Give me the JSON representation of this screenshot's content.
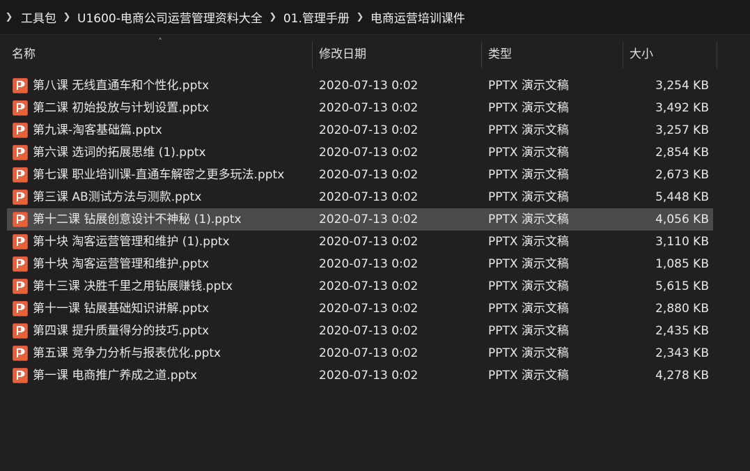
{
  "breadcrumb": {
    "items": [
      "工具包",
      "U1600-电商公司运营管理资料大全",
      "01.管理手册",
      "电商运营培训课件"
    ]
  },
  "columns": {
    "name": "名称",
    "date": "修改日期",
    "type": "类型",
    "size": "大小"
  },
  "icons": {
    "separator": "chevron-right-icon",
    "file": "pptx-file-icon",
    "sort": "sort-ascending-icon"
  },
  "colors": {
    "pptx_icon": "#e8613c",
    "selection": "#4a4a4a"
  },
  "files": [
    {
      "name": "第八课 无线直通车和个性化.pptx",
      "date": "2020-07-13 0:02",
      "type": "PPTX 演示文稿",
      "size": "3,254 KB"
    },
    {
      "name": "第二课 初始投放与计划设置.pptx",
      "date": "2020-07-13 0:02",
      "type": "PPTX 演示文稿",
      "size": "3,492 KB"
    },
    {
      "name": "第九课-淘客基础篇.pptx",
      "date": "2020-07-13 0:02",
      "type": "PPTX 演示文稿",
      "size": "3,257 KB"
    },
    {
      "name": "第六课 选词的拓展思维 (1).pptx",
      "date": "2020-07-13 0:02",
      "type": "PPTX 演示文稿",
      "size": "2,854 KB"
    },
    {
      "name": "第七课 职业培训课-直通车解密之更多玩法.pptx",
      "date": "2020-07-13 0:02",
      "type": "PPTX 演示文稿",
      "size": "2,673 KB"
    },
    {
      "name": "第三课 AB测试方法与测款.pptx",
      "date": "2020-07-13 0:02",
      "type": "PPTX 演示文稿",
      "size": "5,448 KB"
    },
    {
      "name": "第十二课 钻展创意设计不神秘 (1).pptx",
      "date": "2020-07-13 0:02",
      "type": "PPTX 演示文稿",
      "size": "4,056 KB",
      "selected": true
    },
    {
      "name": "第十块 淘客运营管理和维护 (1).pptx",
      "date": "2020-07-13 0:02",
      "type": "PPTX 演示文稿",
      "size": "3,110 KB"
    },
    {
      "name": "第十块 淘客运营管理和维护.pptx",
      "date": "2020-07-13 0:02",
      "type": "PPTX 演示文稿",
      "size": "1,085 KB"
    },
    {
      "name": "第十三课 决胜千里之用钻展赚钱.pptx",
      "date": "2020-07-13 0:02",
      "type": "PPTX 演示文稿",
      "size": "5,615 KB"
    },
    {
      "name": "第十一课 钻展基础知识讲解.pptx",
      "date": "2020-07-13 0:02",
      "type": "PPTX 演示文稿",
      "size": "2,880 KB"
    },
    {
      "name": "第四课 提升质量得分的技巧.pptx",
      "date": "2020-07-13 0:02",
      "type": "PPTX 演示文稿",
      "size": "2,435 KB"
    },
    {
      "name": "第五课 竞争力分析与报表优化.pptx",
      "date": "2020-07-13 0:02",
      "type": "PPTX 演示文稿",
      "size": "2,343 KB"
    },
    {
      "name": "第一课 电商推广养成之道.pptx",
      "date": "2020-07-13 0:02",
      "type": "PPTX 演示文稿",
      "size": "4,278 KB"
    }
  ]
}
